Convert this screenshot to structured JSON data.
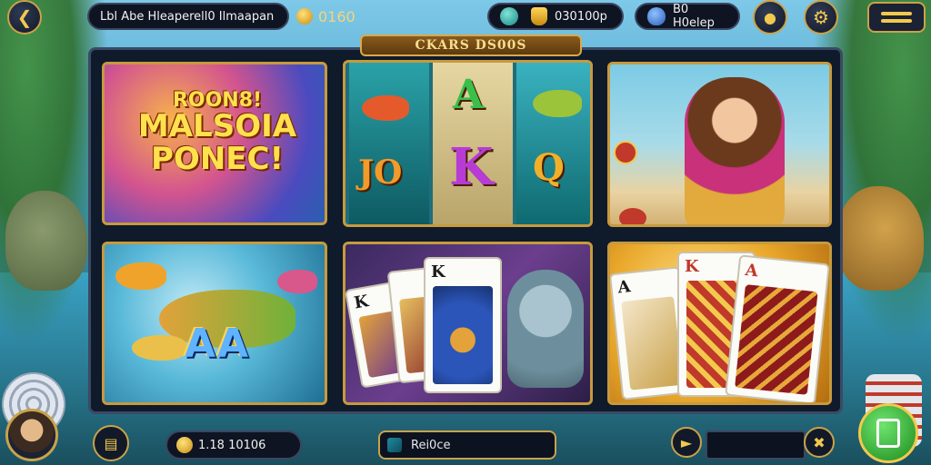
{
  "top_bar": {
    "back_icon": "arrow-left-icon",
    "title": "Lbl Abe Hleaperell0 Ilmaapan",
    "coins": "0160",
    "gems_value": "030100p",
    "shield_label": "B0 H0elep",
    "menu_icon": "hamburger-menu-icon"
  },
  "banner": {
    "label": "CKARS DS00S"
  },
  "games": [
    {
      "name": "tile-1",
      "lines": [
        "ROON8!",
        "MALSOIA",
        "PONEC!"
      ]
    },
    {
      "name": "tile-2",
      "symbols": [
        "JO",
        "A",
        "K",
        "Q"
      ]
    },
    {
      "name": "tile-3"
    },
    {
      "name": "tile-4",
      "text": "AA"
    },
    {
      "name": "tile-5",
      "cards": [
        "K",
        "K"
      ]
    },
    {
      "name": "tile-6",
      "cards": [
        "A",
        "K",
        "A"
      ]
    }
  ],
  "bottom_bar": {
    "balance": "1.18 10106",
    "search_text": "Rei0ce",
    "play_icon": "play-icon"
  },
  "colors": {
    "gold": "#c9a24a",
    "panel": "#0f1a2b",
    "play_green": "#1d8a1d"
  }
}
